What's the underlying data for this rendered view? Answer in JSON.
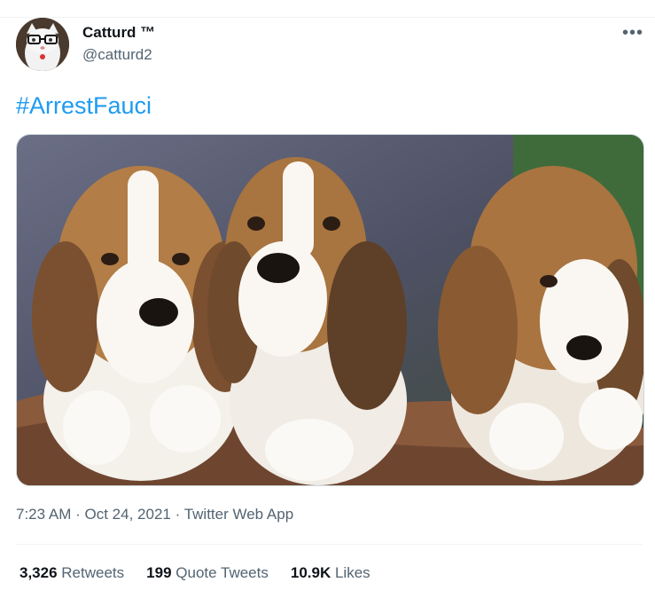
{
  "tweet": {
    "author_name": "Catturd ™",
    "author_handle": "@catturd2",
    "more_icon": "more-icon",
    "text": "#ArrestFauci",
    "time": "7:23 AM",
    "date": "Oct 24, 2021",
    "source": "Twitter Web App",
    "separator": "·"
  },
  "stats": {
    "retweets_count": "3,326",
    "retweets_label": "Retweets",
    "quotes_count": "199",
    "quotes_label": "Quote Tweets",
    "likes_count": "10.9K",
    "likes_label": "Likes"
  },
  "colors": {
    "link": "#1d9bf0",
    "secondary_text": "#536471",
    "primary_text": "#0f1419"
  }
}
